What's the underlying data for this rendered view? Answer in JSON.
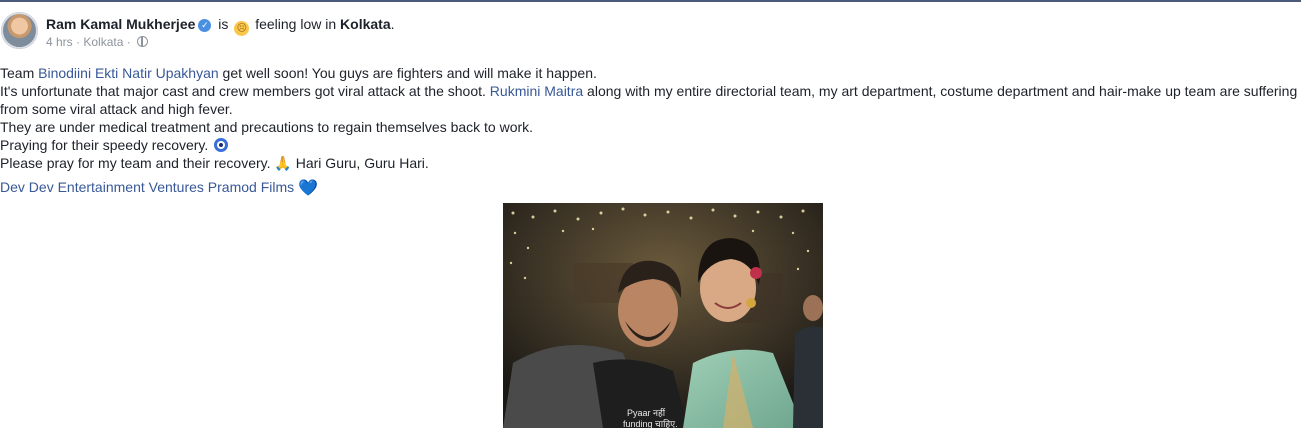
{
  "post": {
    "author": "Ram Kamal Mukherjee",
    "is_word": "is",
    "feeling_text": "feeling low in",
    "location": "Kolkata",
    "period": ".",
    "time": "4 hrs",
    "meta_sep": "·",
    "meta_location": "Kolkata",
    "body": {
      "line1_prefix": "Team",
      "line1_link": "Binodiini Ekti Natir Upakhyan",
      "line1_suffix": "get well soon! You guys are fighters and will make it happen.",
      "line2_prefix": "It's unfortunate that major cast and crew members got viral attack at the shoot.",
      "line2_link": "Rukmini Maitra",
      "line2_suffix": "along with my entire directorial team, my art department, costume department and hair-make up team are suffering from some viral attack and high fever.",
      "line3": "They are under medical treatment and precautions to regain themselves back to work.",
      "line4": "Praying for their speedy recovery.",
      "line5_a": "Please pray for my team and their recovery.",
      "line5_emoji": "🙏",
      "line5_b": "Hari Guru, Guru Hari."
    },
    "tags": [
      "Dev",
      "Dev Entertainment Ventures",
      "Pramod Films"
    ],
    "tags_emoji": "💙"
  },
  "photo": {
    "tshirt_text_1": "Pyaar नहीं",
    "tshirt_text_2": "funding चाहिए."
  },
  "colors": {
    "link": "#385898",
    "meta": "#8d949e",
    "text": "#1d2129"
  }
}
